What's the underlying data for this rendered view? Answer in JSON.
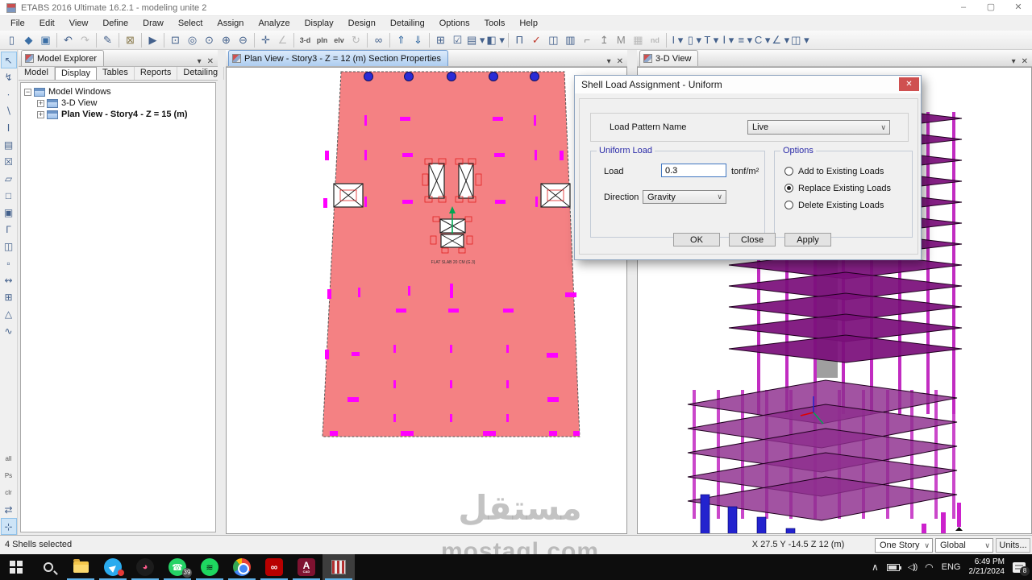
{
  "window": {
    "title": "ETABS 2016 Ultimate 16.2.1 - modeling unite 2",
    "minimize": "–",
    "maximize": "▢",
    "close": "✕"
  },
  "menu": {
    "items": [
      "File",
      "Edit",
      "View",
      "Define",
      "Draw",
      "Select",
      "Assign",
      "Analyze",
      "Display",
      "Design",
      "Detailing",
      "Options",
      "Tools",
      "Help"
    ]
  },
  "toolbar": {
    "icons": [
      {
        "name": "new-model-icon",
        "glyph": "▯"
      },
      {
        "name": "open-file-icon",
        "glyph": "◆",
        "color": "#3a6ea5"
      },
      {
        "name": "save-icon",
        "glyph": "▣",
        "color": "#3a6ea5"
      },
      {
        "sep": true
      },
      {
        "name": "undo-icon",
        "glyph": "↶"
      },
      {
        "name": "redo-icon",
        "glyph": "↷",
        "color": "#b9b9b9"
      },
      {
        "sep": true
      },
      {
        "name": "pen-icon",
        "glyph": "✎"
      },
      {
        "sep": true
      },
      {
        "name": "lock-model-icon",
        "glyph": "⊠",
        "color": "#8a7b4e"
      },
      {
        "sep": true
      },
      {
        "name": "run-analysis-icon",
        "glyph": "▶"
      },
      {
        "sep": true
      },
      {
        "name": "rubber-band-zoom-icon",
        "glyph": "⊡"
      },
      {
        "name": "restore-full-view-icon",
        "glyph": "◎"
      },
      {
        "name": "previous-zoom-icon",
        "glyph": "⊙"
      },
      {
        "name": "zoom-in-icon",
        "glyph": "⊕"
      },
      {
        "name": "zoom-out-icon",
        "glyph": "⊖"
      },
      {
        "sep": true
      },
      {
        "name": "pan-icon",
        "glyph": "✛"
      },
      {
        "name": "measure-icon",
        "glyph": "∠",
        "color": "#b9b9b9"
      },
      {
        "sep": true
      },
      {
        "name": "3d-view-icon",
        "glyph": "3-d",
        "text": true
      },
      {
        "name": "plan-view-icon",
        "glyph": "pln",
        "text": true
      },
      {
        "name": "elevation-view-icon",
        "glyph": "elv",
        "text": true
      },
      {
        "name": "rotate-view-icon",
        "glyph": "↻",
        "color": "#b9b9b9"
      },
      {
        "sep": true
      },
      {
        "name": "view-settings-icon",
        "glyph": "∞"
      },
      {
        "sep": true
      },
      {
        "name": "move-up-list-icon",
        "glyph": "⇑",
        "color": "#3a6ea5"
      },
      {
        "name": "move-down-list-icon",
        "glyph": "⇓",
        "color": "#3a6ea5"
      },
      {
        "sep": true
      },
      {
        "name": "grid-options-icon",
        "glyph": "⊞"
      },
      {
        "name": "object-visibility-icon",
        "glyph": "☑"
      },
      {
        "name": "object-options-icon",
        "glyph": "▤ ▾"
      },
      {
        "name": "shading-options-icon",
        "glyph": "◧ ▾"
      },
      {
        "sep": true
      },
      {
        "name": "draw-portal-icon",
        "glyph": "Π"
      },
      {
        "name": "check-model-icon",
        "glyph": "✓",
        "color": "#c0392b"
      },
      {
        "name": "beam-section-icon",
        "glyph": "◫"
      },
      {
        "name": "column-section-icon",
        "glyph": "▥"
      },
      {
        "name": "wall-corner-icon",
        "glyph": "⌐",
        "color": "#888888"
      },
      {
        "name": "anchor-icon",
        "glyph": "↥",
        "color": "#888888"
      },
      {
        "name": "merge-icon",
        "glyph": "M",
        "color": "#888888"
      },
      {
        "name": "panel-icon",
        "glyph": "▦",
        "color": "#b9b9b9"
      },
      {
        "name": "nd-icon",
        "glyph": "nd",
        "text": true,
        "color": "#b9b9b9"
      },
      {
        "sep": true
      },
      {
        "name": "draw-joint-icon",
        "glyph": "I ▾"
      },
      {
        "name": "draw-frame-icon",
        "glyph": "▯ ▾"
      },
      {
        "name": "draw-quick-frame-icon",
        "glyph": "T ▾"
      },
      {
        "name": "draw-beam-icon",
        "glyph": "Ⅰ ▾"
      },
      {
        "name": "draw-tendon-icon",
        "glyph": "≡ ▾"
      },
      {
        "name": "draw-wall-icon",
        "glyph": "C ▾"
      },
      {
        "name": "draw-link-icon",
        "glyph": "∠ ▾"
      },
      {
        "name": "draw-floor-icon",
        "glyph": "◫ ▾"
      }
    ]
  },
  "left_toolbar": {
    "icons": [
      {
        "name": "select-pointer-icon",
        "glyph": "↖",
        "active": true
      },
      {
        "name": "reshape-icon",
        "glyph": "↯"
      },
      {
        "name": "draw-joint-icon",
        "glyph": "∙"
      },
      {
        "name": "draw-frame-line-icon",
        "glyph": "∖"
      },
      {
        "name": "quick-draw-frame-icon",
        "glyph": "Ⅰ"
      },
      {
        "name": "quick-draw-beams-icon",
        "glyph": "▤"
      },
      {
        "name": "quick-draw-braces-icon",
        "glyph": "☒"
      },
      {
        "name": "draw-floor-icon",
        "glyph": "▱"
      },
      {
        "name": "draw-rect-floor-icon",
        "glyph": "□"
      },
      {
        "name": "quick-draw-floor-icon",
        "glyph": "▣"
      },
      {
        "name": "draw-wall-icon",
        "glyph": "Γ"
      },
      {
        "name": "quick-draw-wall-icon",
        "glyph": "◫"
      },
      {
        "name": "draw-opening-icon",
        "glyph": "▫"
      },
      {
        "name": "draw-link-icon",
        "glyph": "↭"
      },
      {
        "name": "draw-grid-icon",
        "glyph": "⊞"
      },
      {
        "name": "draw-dimension-icon",
        "glyph": "△"
      },
      {
        "name": "draw-curve-icon",
        "glyph": "∿"
      },
      {
        "spacer": true
      },
      {
        "name": "select-all-icon",
        "glyph": "all",
        "text": true
      },
      {
        "name": "select-previous-icon",
        "glyph": "Ps",
        "text": true
      },
      {
        "name": "clear-selection-icon",
        "glyph": "clr",
        "text": true
      },
      {
        "name": "invert-selection-icon",
        "glyph": "⇄"
      },
      {
        "name": "snap-options-icon",
        "glyph": "⊹",
        "active": true
      }
    ]
  },
  "model_explorer": {
    "title": "Model Explorer",
    "tabs": [
      "Model",
      "Display",
      "Tables",
      "Reports",
      "Detailing"
    ],
    "active_tab": "Display",
    "tree": [
      {
        "label": "Model Windows",
        "level": 0,
        "expander": "−"
      },
      {
        "label": "3-D View",
        "level": 1,
        "expander": "+"
      },
      {
        "label": "Plan View - Story4 - Z = 15 (m)",
        "level": 1,
        "expander": "+",
        "bold": true
      }
    ]
  },
  "plan_view": {
    "tab_title": "Plan View - Story3 - Z = 12 (m)  Section Properties",
    "slab_label": "FLAT SLAB 20 CM (G.3)"
  },
  "three_d_view": {
    "tab_title": "3-D View"
  },
  "dialog": {
    "title": "Shell Load Assignment - Uniform",
    "close_glyph": "✕",
    "load_pattern_label": "Load Pattern Name",
    "load_pattern_value": "Live",
    "uniform_load_group": "Uniform Load",
    "load_label": "Load",
    "load_value": "0.3",
    "load_unit": "tonf/m²",
    "direction_label": "Direction",
    "direction_value": "Gravity",
    "options_group": "Options",
    "options": [
      {
        "label": "Add to Existing Loads",
        "selected": false
      },
      {
        "label": "Replace Existing Loads",
        "selected": true
      },
      {
        "label": "Delete Existing Loads",
        "selected": false
      }
    ],
    "ok": "OK",
    "close": "Close",
    "apply": "Apply"
  },
  "status_bar": {
    "message": "4 Shells selected",
    "coordinates": "X 27.5  Y -14.5  Z 12 (m)",
    "story_mode": "One Story",
    "coord_system": "Global",
    "units_button": "Units..."
  },
  "taskbar": {
    "apps": [
      {
        "name": "start-button",
        "type": "start"
      },
      {
        "name": "search-button",
        "type": "search"
      },
      {
        "name": "file-explorer",
        "type": "folder"
      },
      {
        "name": "telegram",
        "type": "circle",
        "bg": "#2AABEE",
        "glyph": "▶",
        "fg": "#ffffff",
        "rot": true,
        "dot": true
      },
      {
        "name": "pink-media-app",
        "type": "circle",
        "bg": "#1c1c1c",
        "glyph": "◕",
        "fg": "#ff5b8d"
      },
      {
        "name": "whatsapp",
        "type": "circle",
        "bg": "#25D366",
        "glyph": "☎",
        "fg": "#ffffff",
        "badge": "39"
      },
      {
        "name": "spotify",
        "type": "circle",
        "bg": "#1ED760",
        "glyph": "≋",
        "fg": "#101010"
      },
      {
        "name": "chrome",
        "type": "chrome"
      },
      {
        "name": "acrobat",
        "type": "square",
        "bg": "#b80000",
        "glyph": "∞",
        "fg": "#ffffff"
      },
      {
        "name": "autocad",
        "type": "square",
        "bg": "#7e1230",
        "glyph": "A",
        "fg": "#ffffff",
        "sub": "CAD"
      },
      {
        "name": "etabs",
        "type": "etabs",
        "active": true
      }
    ],
    "tray": {
      "chevron": "∧",
      "speaker": "◁))",
      "wifi": "◠",
      "language": "ENG",
      "time": "6:49 PM",
      "date": "2/21/2024",
      "notification_count": "8"
    }
  },
  "watermark": {
    "arabic": "مستقل",
    "domain": "mostaql.com"
  },
  "colors": {
    "slab": "#F48183",
    "dash": "#FF00FF",
    "model_purple": "#7B0F7B",
    "podium_purple": "#8E2D8E",
    "column_blue": "#2323CE",
    "accent_magenta": "#C128C1"
  }
}
